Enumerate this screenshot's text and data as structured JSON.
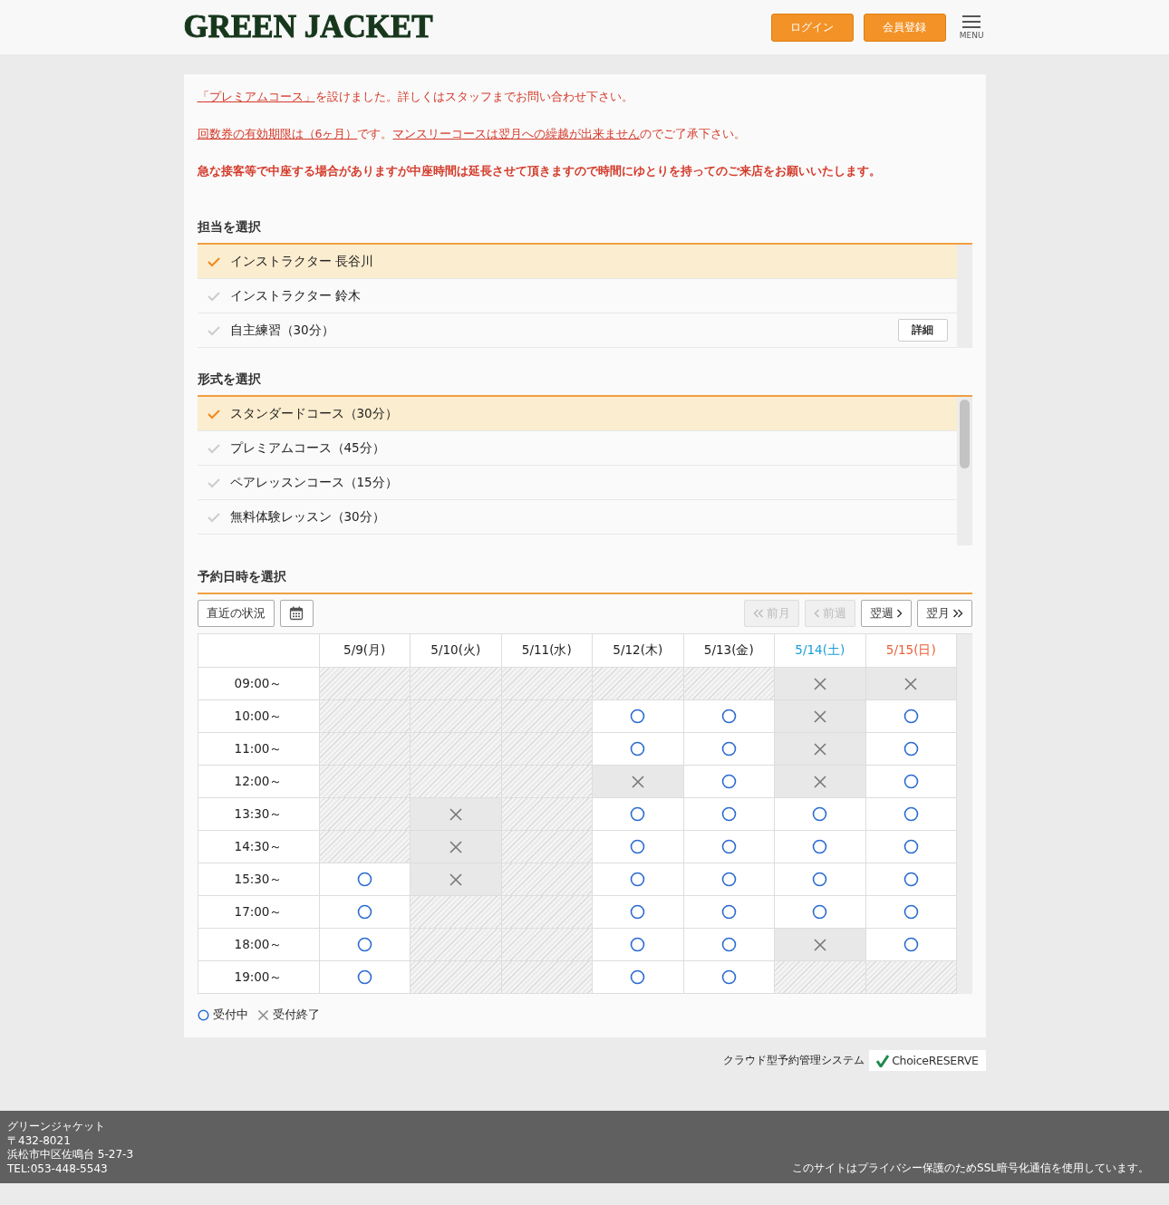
{
  "header": {
    "logo": "GREEN JACKET",
    "buttons": [
      "ログイン",
      "会員登録"
    ],
    "menu_label": "MENU"
  },
  "notices": [
    {
      "kind": "normal",
      "parts": [
        {
          "text": "「プレミアムコース」",
          "link": true
        },
        {
          "text": "を設けました。詳しくはスタッフまでお問い合わせ下さい。",
          "link": false
        }
      ]
    },
    {
      "kind": "normal",
      "parts": [
        {
          "text": "回数券の有効期限は（6ヶ月）",
          "link": true
        },
        {
          "text": "です。",
          "link": false
        },
        {
          "text": "マンスリーコースは翌月への繰越が出来ません",
          "link": true
        },
        {
          "text": "のでご了承下さい。",
          "link": false
        }
      ]
    },
    {
      "kind": "bold",
      "parts": [
        {
          "text": "急な接客等で中座する場合がありますが中座時間は延長させて頂きますので時間にゆとりを持ってのご来店をお願いいたします。",
          "link": false
        }
      ]
    }
  ],
  "staff": {
    "title": "担当を選択",
    "items": [
      {
        "label": "インストラクター 長谷川",
        "selected": true
      },
      {
        "label": "インストラクター 鈴木",
        "selected": false
      },
      {
        "label": "自主練習（30分）",
        "selected": false,
        "detail": "詳細"
      }
    ]
  },
  "course": {
    "title": "形式を選択",
    "items": [
      {
        "label": "スタンダードコース（30分）",
        "selected": true
      },
      {
        "label": "プレミアムコース（45分）",
        "selected": false
      },
      {
        "label": "ペアレッスンコース（15分）",
        "selected": false
      },
      {
        "label": "無料体験レッスン（30分）",
        "selected": false
      }
    ]
  },
  "schedule": {
    "title": "予約日時を選択",
    "recent_button": "直近の状況",
    "nav": [
      {
        "label": "前月",
        "kind": "prev2",
        "disabled": true
      },
      {
        "label": "前週",
        "kind": "prev",
        "disabled": true
      },
      {
        "label": "翌週",
        "kind": "next",
        "disabled": false
      },
      {
        "label": "翌月",
        "kind": "next2",
        "disabled": false
      }
    ],
    "days": [
      {
        "label": "5/9(月)",
        "color": "#222222"
      },
      {
        "label": "5/10(火)",
        "color": "#222222"
      },
      {
        "label": "5/11(水)",
        "color": "#222222"
      },
      {
        "label": "5/12(木)",
        "color": "#222222"
      },
      {
        "label": "5/13(金)",
        "color": "#222222"
      },
      {
        "label": "5/14(土)",
        "color": "#1a9fd6"
      },
      {
        "label": "5/15(日)",
        "color": "#e8613a"
      }
    ],
    "rows": [
      {
        "time": "09:00～",
        "cells": [
          {
            "kind": "none"
          },
          {
            "kind": "none"
          },
          {
            "kind": "none"
          },
          {
            "kind": "none"
          },
          {
            "kind": "none"
          },
          {
            "kind": "full"
          },
          {
            "kind": "full"
          }
        ]
      },
      {
        "time": "10:00～",
        "cells": [
          {
            "kind": "none"
          },
          {
            "kind": "none"
          },
          {
            "kind": "none"
          },
          {
            "kind": "open"
          },
          {
            "kind": "open"
          },
          {
            "kind": "full"
          },
          {
            "kind": "open"
          }
        ]
      },
      {
        "time": "11:00～",
        "cells": [
          {
            "kind": "none"
          },
          {
            "kind": "none"
          },
          {
            "kind": "none"
          },
          {
            "kind": "open"
          },
          {
            "kind": "open"
          },
          {
            "kind": "full"
          },
          {
            "kind": "open"
          }
        ]
      },
      {
        "time": "12:00～",
        "cells": [
          {
            "kind": "none"
          },
          {
            "kind": "none"
          },
          {
            "kind": "none"
          },
          {
            "kind": "full"
          },
          {
            "kind": "open"
          },
          {
            "kind": "full"
          },
          {
            "kind": "open"
          }
        ]
      },
      {
        "time": "13:30～",
        "cells": [
          {
            "kind": "none"
          },
          {
            "kind": "full"
          },
          {
            "kind": "none"
          },
          {
            "kind": "open"
          },
          {
            "kind": "open"
          },
          {
            "kind": "open"
          },
          {
            "kind": "open"
          }
        ]
      },
      {
        "time": "14:30～",
        "cells": [
          {
            "kind": "none"
          },
          {
            "kind": "full"
          },
          {
            "kind": "none"
          },
          {
            "kind": "open"
          },
          {
            "kind": "open"
          },
          {
            "kind": "open"
          },
          {
            "kind": "open"
          }
        ]
      },
      {
        "time": "15:30～",
        "cells": [
          {
            "kind": "open"
          },
          {
            "kind": "full"
          },
          {
            "kind": "none"
          },
          {
            "kind": "open"
          },
          {
            "kind": "open"
          },
          {
            "kind": "open"
          },
          {
            "kind": "open"
          }
        ]
      },
      {
        "time": "17:00～",
        "cells": [
          {
            "kind": "open"
          },
          {
            "kind": "none"
          },
          {
            "kind": "none"
          },
          {
            "kind": "open"
          },
          {
            "kind": "open"
          },
          {
            "kind": "open"
          },
          {
            "kind": "open"
          }
        ]
      },
      {
        "time": "18:00～",
        "cells": [
          {
            "kind": "open"
          },
          {
            "kind": "none"
          },
          {
            "kind": "none"
          },
          {
            "kind": "open"
          },
          {
            "kind": "open"
          },
          {
            "kind": "full"
          },
          {
            "kind": "open"
          }
        ]
      },
      {
        "time": "19:00～",
        "cells": [
          {
            "kind": "open"
          },
          {
            "kind": "none"
          },
          {
            "kind": "none"
          },
          {
            "kind": "open"
          },
          {
            "kind": "open"
          },
          {
            "kind": "none"
          },
          {
            "kind": "none"
          }
        ]
      }
    ],
    "legend": [
      {
        "kind": "open",
        "label": "受付中"
      },
      {
        "kind": "full",
        "label": "受付終了"
      }
    ]
  },
  "powered": {
    "label": "クラウド型予約管理システム",
    "brand": "ChoiceRESERVE"
  },
  "footer": {
    "address": [
      "グリーンジャケット",
      "〒432-8021",
      "浜松市中区佐鳴台 5-27-3",
      "TEL:053-448-5543"
    ],
    "ssl": "このサイトはプライバシー保護のためSSL暗号化通信を使用しています。"
  }
}
